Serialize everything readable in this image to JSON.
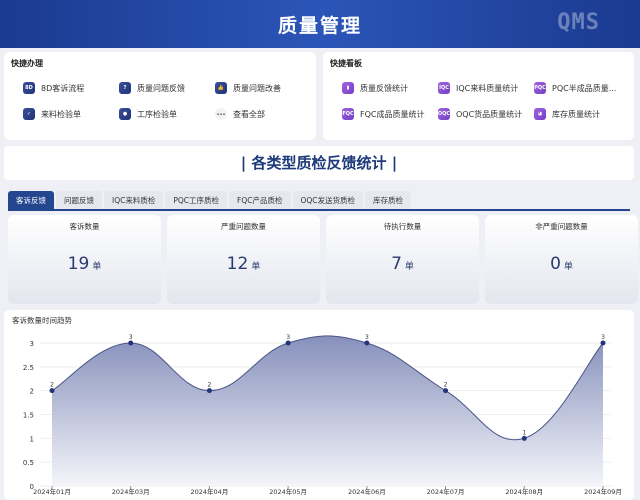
{
  "header": {
    "title": "质量管理",
    "logo": "QMS"
  },
  "quick_handle": {
    "title": "快捷办理",
    "items": [
      {
        "label": "8D客诉流程",
        "icon": "8d-icon",
        "badge": "8D"
      },
      {
        "label": "质量问题反馈",
        "icon": "question-icon",
        "badge": "?"
      },
      {
        "label": "质量问题改善",
        "icon": "thumbs-up-icon",
        "badge": "👍"
      },
      {
        "label": "来料检验单",
        "icon": "shield-icon",
        "badge": "✓"
      },
      {
        "label": "工序检验单",
        "icon": "disc-icon",
        "badge": "●"
      },
      {
        "label": "查看全部",
        "icon": "more-icon",
        "badge": "···"
      }
    ]
  },
  "quick_board": {
    "title": "快捷看板",
    "items": [
      {
        "label": "质量反馈统计",
        "icon": "bar-chart-icon",
        "badge": "▮"
      },
      {
        "label": "IQC来料质量统计",
        "icon": "iqc-icon",
        "badge": "IQC"
      },
      {
        "label": "PQC半成品质量...",
        "icon": "pqc-icon",
        "badge": "PQC"
      },
      {
        "label": "FQC成品质量统计",
        "icon": "fqc-icon",
        "badge": "FQC"
      },
      {
        "label": "OQC货品质量统计",
        "icon": "oqc-icon",
        "badge": "OQC"
      },
      {
        "label": "库存质量统计",
        "icon": "pie-icon",
        "badge": "◕"
      }
    ]
  },
  "section_title": "| 各类型质检反馈统计 |",
  "tabs": [
    {
      "label": "客诉反馈",
      "active": true
    },
    {
      "label": "问题反馈"
    },
    {
      "label": "IQC来料质检"
    },
    {
      "label": "PQC工序质检"
    },
    {
      "label": "FQC产品质检"
    },
    {
      "label": "OQC发送货质检"
    },
    {
      "label": "库存质检"
    }
  ],
  "cards": [
    {
      "label": "客诉数量",
      "value": "19",
      "unit": "单"
    },
    {
      "label": "严重问题数量",
      "value": "12",
      "unit": "单"
    },
    {
      "label": "待执行数量",
      "value": "7",
      "unit": "单"
    },
    {
      "label": "非严重问题数量",
      "value": "0",
      "unit": "单"
    }
  ],
  "colors": {
    "primary": "#24468f",
    "accent_purple": "#8a52d6"
  },
  "chart_data": {
    "type": "area",
    "title": "客诉数量时间趋势",
    "categories": [
      "2024年01月",
      "2024年03月",
      "2024年04月",
      "2024年05月",
      "2024年06月",
      "2024年07月",
      "2024年08月",
      "2024年09月"
    ],
    "values": [
      2,
      3,
      2,
      3,
      3,
      2,
      1,
      3
    ],
    "ylim": [
      0,
      3
    ],
    "yticks": [
      "0",
      "0.5",
      "1",
      "1.5",
      "2",
      "2.5",
      "3"
    ],
    "grid": true,
    "smooth": true,
    "data_labels": true
  }
}
